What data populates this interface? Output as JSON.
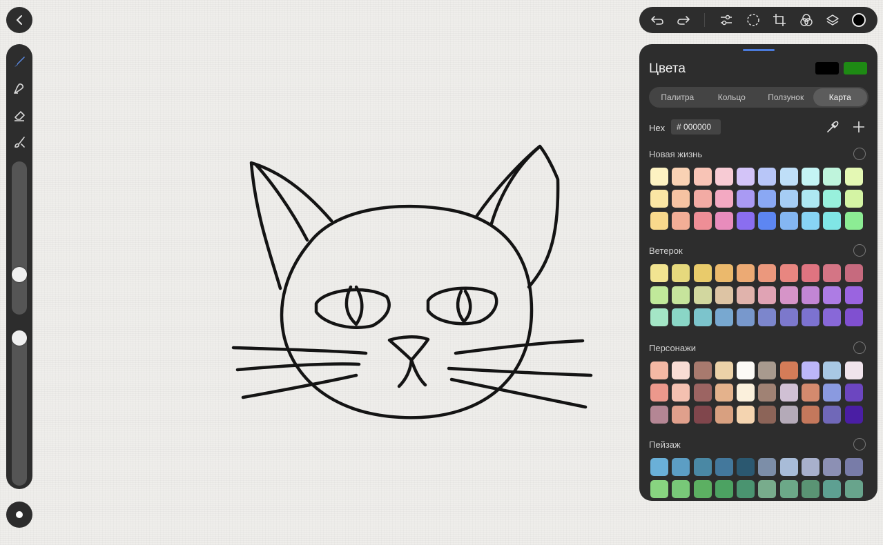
{
  "panel": {
    "title": "Цвета",
    "current_color": "#000000",
    "previous_color": "#1e8a14",
    "tabs": [
      {
        "label": "Палитра",
        "active": false
      },
      {
        "label": "Кольцо",
        "active": false
      },
      {
        "label": "Ползунок",
        "active": false
      },
      {
        "label": "Карта",
        "active": true
      }
    ],
    "hex_label": "Hex",
    "hex_value": "# 000000"
  },
  "toolbar": {
    "icons": [
      "undo-icon",
      "redo-icon",
      "adjustments-icon",
      "selection-icon",
      "transform-icon",
      "blend-icon",
      "layers-icon"
    ],
    "active_color": "#000000"
  },
  "left_tools": [
    "brush-icon",
    "smudge-icon",
    "eraser-icon",
    "paint-icon"
  ],
  "sliders": {
    "brush_size": 0.71,
    "opacity": 1.0
  },
  "palettes": [
    {
      "name": "Новая жизнь",
      "colors": [
        [
          "#fdf2c2",
          "#f9d2b4",
          "#f8c4b6",
          "#f7cbd4",
          "#d3c4f8",
          "#b8c6f8",
          "#bfdff8",
          "#c4f4f4",
          "#bff4dc",
          "#e4f8b4"
        ],
        [
          "#fbe6a4",
          "#f6c3a2",
          "#f3aba4",
          "#f3a9c2",
          "#a99af3",
          "#8aa8f4",
          "#a6cdf4",
          "#aee8f2",
          "#98f0dc",
          "#d4f4a4"
        ],
        [
          "#f9d98c",
          "#f3ae96",
          "#ee8e96",
          "#e88cbc",
          "#8a6ef0",
          "#5d86f2",
          "#84b6f2",
          "#88d4f4",
          "#80e6e6",
          "#8cec94"
        ]
      ]
    },
    {
      "name": "Ветерок",
      "colors": [
        [
          "#f2e491",
          "#e6d97d",
          "#e9cb6b",
          "#ebb96c",
          "#ecaa74",
          "#eb987d",
          "#e88680",
          "#df7480",
          "#d47585",
          "#c66a7e"
        ],
        [
          "#c0e99a",
          "#c6e49c",
          "#d2d79f",
          "#ddc4a4",
          "#e0b3ac",
          "#e0a3b4",
          "#d694c8",
          "#c286d4",
          "#ad7ce4",
          "#9a64e0"
        ],
        [
          "#a4e6c6",
          "#8ad6c6",
          "#7cc4cc",
          "#78a8d0",
          "#7898cc",
          "#7c86cc",
          "#7c78cc",
          "#7c72d0",
          "#8868d8",
          "#8050d0"
        ]
      ]
    },
    {
      "name": "Персонажи",
      "colors": [
        [
          "#f4b8a4",
          "#f8dcd4",
          "#a87a6e",
          "#ecd2a8",
          "#fcfaf6",
          "#a89a8e",
          "#d47c58",
          "#bcb6f8",
          "#a8c8e4",
          "#f0e4ec"
        ],
        [
          "#ec988c",
          "#f4c0b0",
          "#9c6462",
          "#e4b28c",
          "#fbf0dc",
          "#a08274",
          "#d0c0d4",
          "#d48a6e",
          "#8a9ae0",
          "#6c46c0"
        ],
        [
          "#b48694",
          "#e0a08c",
          "#80464c",
          "#d8a080",
          "#f4d4b0",
          "#8c6458",
          "#b4aab8",
          "#c4785c",
          "#7068b8",
          "#4a1ea4"
        ]
      ]
    },
    {
      "name": "Пейзаж",
      "colors": [
        [
          "#6ab0d8",
          "#5c9ec4",
          "#4a88a4",
          "#43789c",
          "#2b5870",
          "#7c8ea8",
          "#a8bcd8",
          "#a8b0cc",
          "#8c90b4",
          "#787ca8"
        ],
        [
          "#88d480",
          "#78c878",
          "#5cb062",
          "#4ca262",
          "#4a9470",
          "#78ac8c",
          "#6ca888",
          "#5a9474",
          "#5ea092",
          "#68a48c"
        ]
      ]
    }
  ]
}
